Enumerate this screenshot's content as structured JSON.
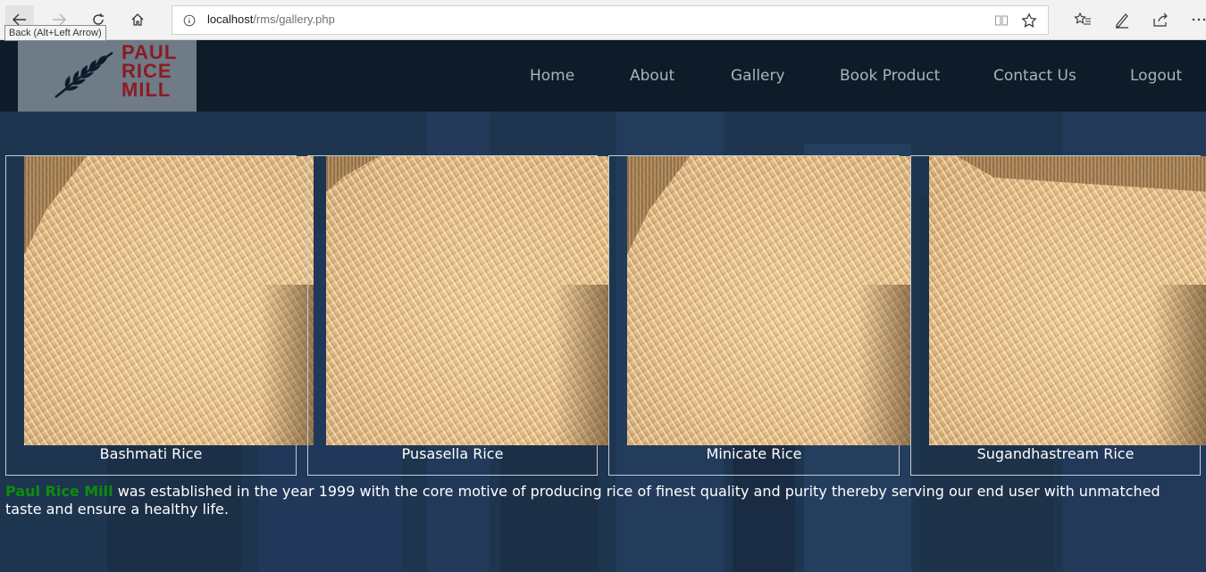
{
  "browser": {
    "back_tooltip": "Back (Alt+Left Arrow)",
    "url_host": "localhost",
    "url_path": "/rms/gallery.php"
  },
  "site": {
    "logo_lines": [
      "PAUL",
      "RICE",
      "MILL"
    ],
    "nav": [
      "Home",
      "About",
      "Gallery",
      "Book Product",
      "Contact Us",
      "Logout"
    ]
  },
  "gallery": [
    {
      "caption": "Bashmati Rice"
    },
    {
      "caption": "Pusasella Rice"
    },
    {
      "caption": "Minicate Rice"
    },
    {
      "caption": "Sugandhastream Rice"
    }
  ],
  "about": {
    "brand": "Paul Rice Mill",
    "text": " was established in the year 1999 with the core motive of producing rice of finest quality and purity thereby serving our end user with unmatched taste and ensure a healthy life."
  },
  "colors": {
    "logo_text": "#8b1b24",
    "brand_highlight": "#0c8d0c",
    "nav_text": "#a8b4bf"
  }
}
